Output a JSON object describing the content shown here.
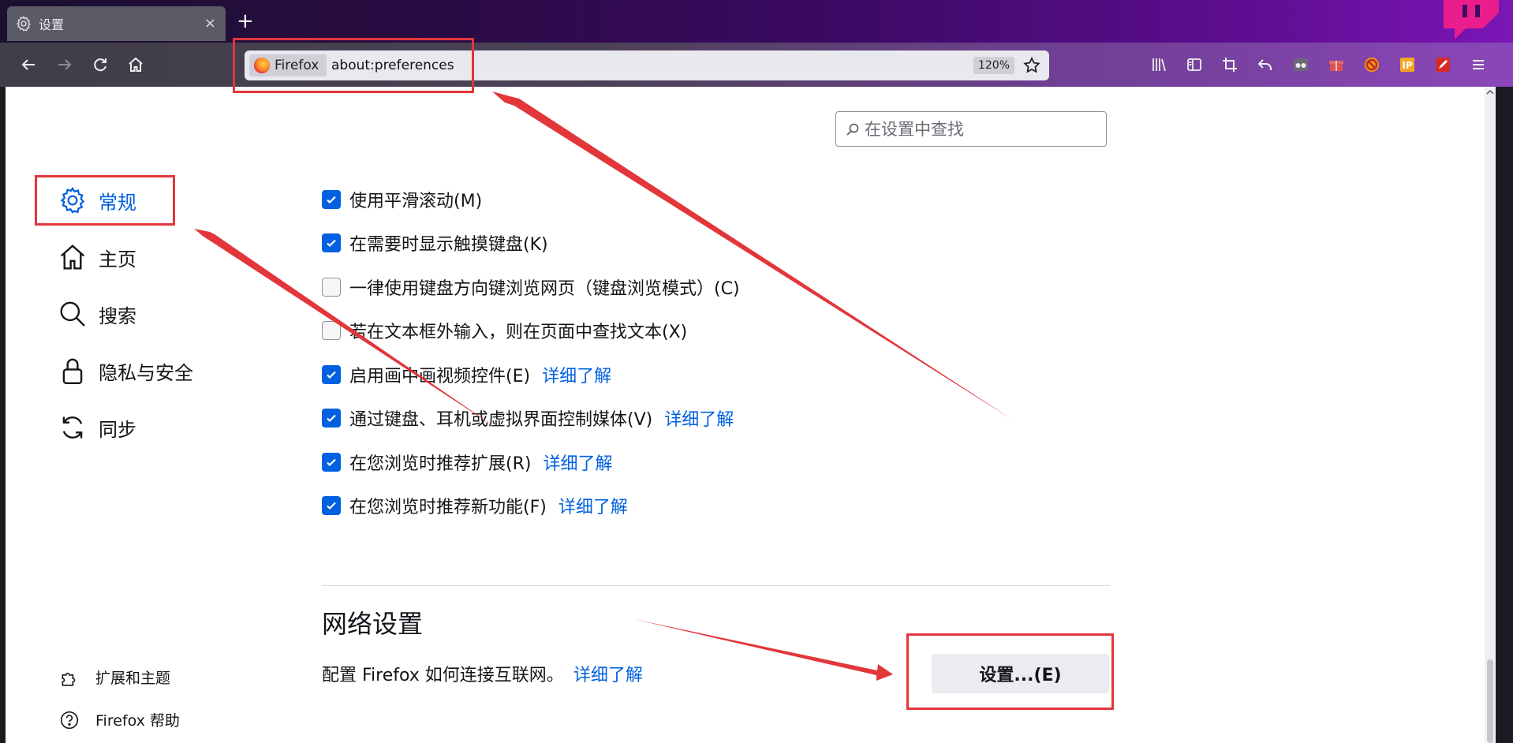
{
  "browser": {
    "tab": {
      "title": "设置",
      "close": "×"
    },
    "new_tab": "+",
    "identity_label": "Firefox",
    "url": "about:preferences",
    "zoom": "120%"
  },
  "search": {
    "placeholder": "在设置中查找"
  },
  "sidebar": {
    "categories": [
      {
        "label": "常规",
        "icon": "gear-icon",
        "active": true
      },
      {
        "label": "主页",
        "icon": "home-icon"
      },
      {
        "label": "搜索",
        "icon": "search-icon"
      },
      {
        "label": "隐私与安全",
        "icon": "lock-icon"
      },
      {
        "label": "同步",
        "icon": "sync-icon"
      }
    ],
    "footer": [
      {
        "label": "扩展和主题",
        "icon": "puzzle-icon"
      },
      {
        "label": "Firefox 帮助",
        "icon": "help-icon"
      }
    ]
  },
  "options": [
    {
      "label": "使用平滑滚动(M)",
      "checked": true
    },
    {
      "label": "在需要时显示触摸键盘(K)",
      "checked": true
    },
    {
      "label": "一律使用键盘方向键浏览网页（键盘浏览模式）(C)",
      "checked": false
    },
    {
      "label": "若在文本框外输入，则在页面中查找文本(X)",
      "checked": false
    },
    {
      "label": "启用画中画视频控件(E)",
      "checked": true,
      "link": "详细了解"
    },
    {
      "label": "通过键盘、耳机或虚拟界面控制媒体(V)",
      "checked": true,
      "link": "详细了解"
    },
    {
      "label": "在您浏览时推荐扩展(R)",
      "checked": true,
      "link": "详细了解"
    },
    {
      "label": "在您浏览时推荐新功能(F)",
      "checked": true,
      "link": "详细了解"
    }
  ],
  "network": {
    "heading": "网络设置",
    "description": "配置 Firefox 如何连接互联网。",
    "link": "详细了解",
    "button": "设置...(E)"
  },
  "colors": {
    "accent": "#0061e0",
    "annotation": "#e2363a"
  }
}
